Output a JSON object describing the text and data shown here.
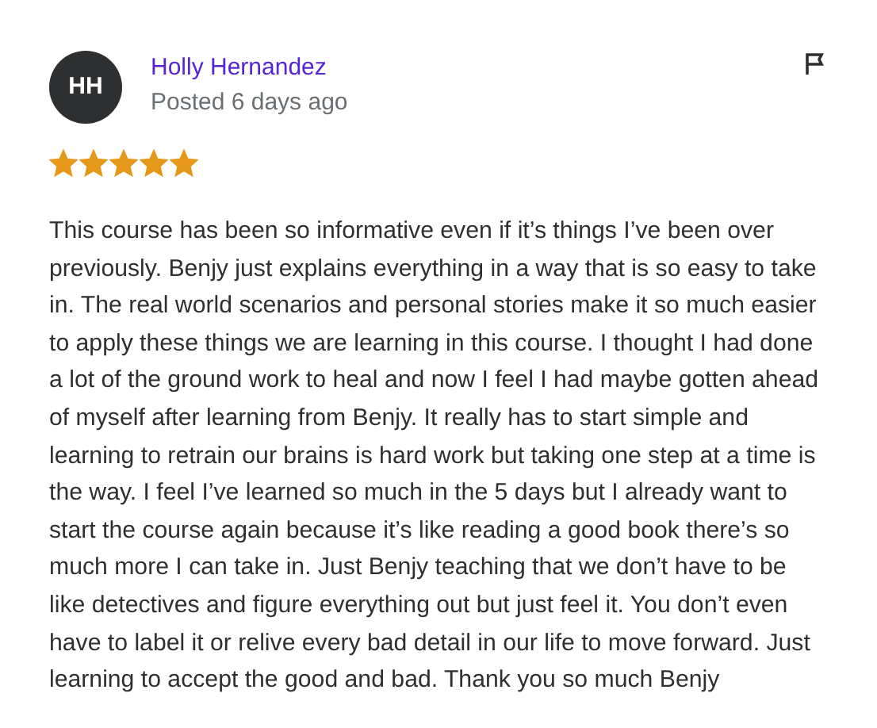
{
  "review": {
    "avatar_initials": "HH",
    "name": "Holly Hernandez",
    "posted": "Posted 6 days ago",
    "stars": 5,
    "text": "This course has been so informative even if it’s things I’ve been over previously. Benjy just explains everything in a way that is so easy to take in. The real world scenarios and personal stories make it so much easier to apply these things we are learning in this course. I thought I had done a lot of the ground work to heal and now I feel I had maybe gotten ahead of myself after learning from Benjy. It really has to start simple and learning to retrain our brains is hard work but taking one step at a time is the way. I feel I’ve learned so much in the 5 days but I already want to start the course again because it’s like reading a good book there’s so much more I can take in. Just Benjy teaching that we don’t have to be like detectives and figure everything out but just feel it. You don’t even have to label it or relive every bad detail in our life to move forward. Just learning to accept the good and bad. Thank you so much Benjy"
  }
}
